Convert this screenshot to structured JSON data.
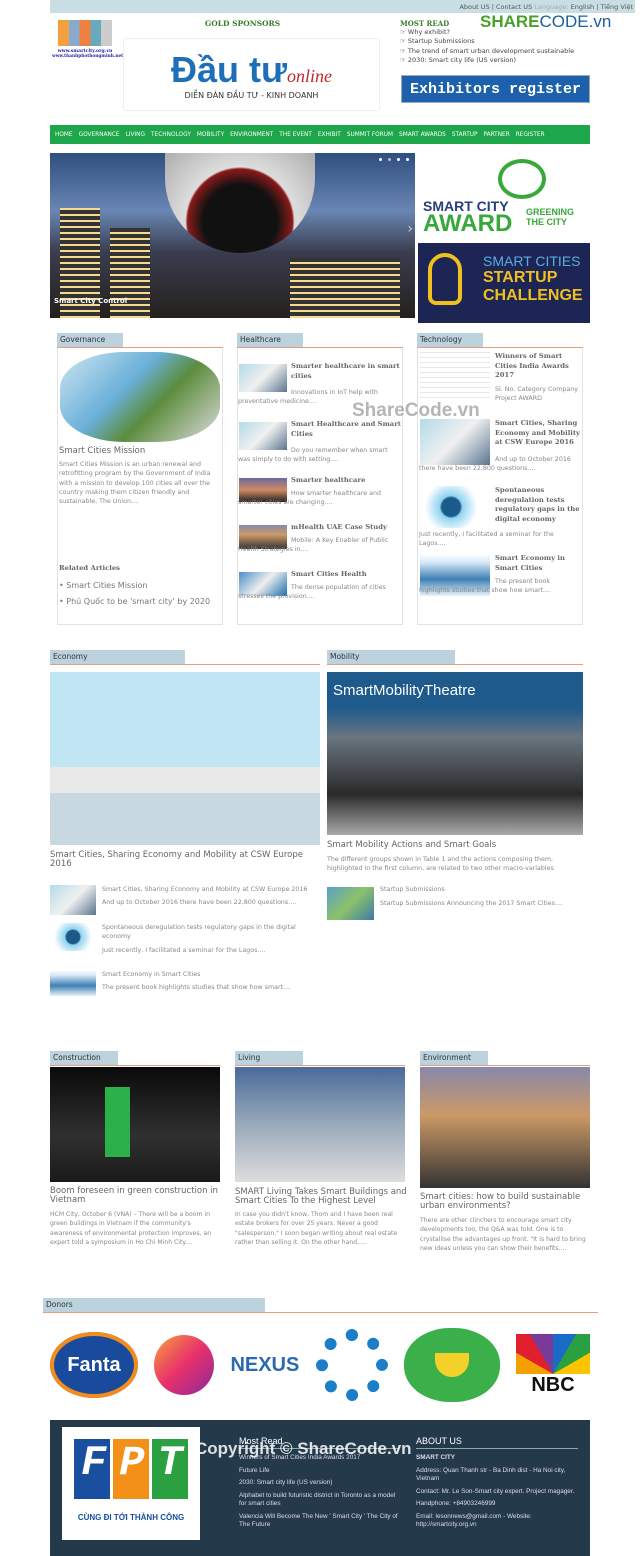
{
  "topbar": {
    "about": "About US",
    "contact": "Contact US",
    "language_label": "Language:",
    "english": "English",
    "vietnamese": "Tiếng Việt"
  },
  "logo": {
    "line1": "www.smartcity.org.vn",
    "line2": "www.thanhphothongminh.net"
  },
  "sponsors": {
    "title": "GOLD SPONSORS",
    "brand_main": "Đầu tư",
    "brand_script": "online",
    "brand_sub": "DIỄN ĐÀN ĐẦU TƯ - KINH DOANH"
  },
  "most_read_header": {
    "title": "MOST READ",
    "items": [
      "Why exhibit?",
      "Startup Submissions",
      "The trend of smart urban development sustainable",
      "2030: Smart city life (US version)"
    ]
  },
  "watermark": {
    "brand": "SHARE",
    "brand2": "CODE.vn",
    "mid": "ShareCode.vn",
    "footer": "Copyright © ShareCode.vn"
  },
  "exhibitors_banner": "Exhibitors register now",
  "nav": [
    "HOME",
    "GOVERNANCE",
    "LIVING",
    "TECHNOLOGY",
    "MOBILITY",
    "ENVIRONMENT",
    "THE EVENT",
    "EXHIBIT",
    "SUMMIT FORUM",
    "SMART AWARDS",
    "STARTUP",
    "PARTNER",
    "REGISTER"
  ],
  "hero": {
    "caption": "Smart City Control",
    "slide_count": 4,
    "active_slide": 2
  },
  "award": {
    "l1": "SMART CITY",
    "l2": "AWARD",
    "l3": "GREENING",
    "l4": "THE CITY"
  },
  "startup": {
    "l1": "SMART CITIES",
    "l2": "STARTUP",
    "l3": "CHALLENGE"
  },
  "governance": {
    "title": "Governance",
    "headline": "Smart Cities Mission",
    "summary": "Smart Cities Mission is an urban renewal and retrofitting program by the Government of India with a mission to develop 100 cities all over the country making them citizen friendly and sustainable. The Union....",
    "related_title": "Related Articles",
    "related": [
      "Smart Cities Mission",
      "Phú Quốc to be 'smart city' by 2020"
    ]
  },
  "healthcare": {
    "title": "Healthcare",
    "items": [
      {
        "title": "Smarter healthcare in smart cities",
        "text": "Innovations in IoT help with preventative medicine...."
      },
      {
        "title": "Smart Healthcare and Smart Cities",
        "text": "Do you remember when smart was simply to do with setting...."
      },
      {
        "title": "Smarter healthcare",
        "text": "How smarter healthcare and smarter cities are changing...."
      },
      {
        "title": "mHealth UAE Case Study",
        "text": "Mobile: A Key Enabler of Public Health Strategies in...."
      },
      {
        "title": "Smart Cities Health",
        "text": "The dense population of cities stresses the provision...."
      }
    ]
  },
  "technology": {
    "title": "Technology",
    "items": [
      {
        "title": "Winners of Smart Cities India Awards 2017",
        "text": "Sl. No. Category Company Project AWARD"
      },
      {
        "title": "Smart Cities, Sharing Economy and Mobility at CSW Europe 2016",
        "text": "And up to October 2016 there have been 22,800 questions...."
      },
      {
        "title": "Spontaneous deregulation tests regulatory gaps in the digital economy",
        "text": "Just recently, I facilitated a seminar for the Lagos...."
      },
      {
        "title": "Smart Economy in Smart Cities",
        "text": "The present book highlights studies that show how smart...."
      }
    ]
  },
  "economy": {
    "title": "Economy",
    "headline": "Smart Cities, Sharing Economy and Mobility at CSW Europe 2016",
    "items": [
      {
        "title": "Smart Cities, Sharing Economy and Mobility at CSW Europe 2016",
        "text": "And up to October 2016 there have been 22,800 questions...."
      },
      {
        "title": "Spontaneous deregulation tests regulatory gaps in the digital economy",
        "text": "Just recently, I facilitated a seminar for the Lagos...."
      },
      {
        "title": "Smart Economy in Smart Cities",
        "text": "The present book highlights studies that show how smart...."
      }
    ]
  },
  "mobility": {
    "title": "Mobility",
    "image_text": "SmartMobilityTheatre",
    "headline": "Smart Mobility Actions and Smart Goals",
    "summary": "The different groups shown in Table 1 and the actions composing them, highlighted in the first column, are related to two other macro-variables",
    "items": [
      {
        "title": "Startup Submissions",
        "text": "Startup Submissions Announcing the 2017 Smart Cities...."
      }
    ]
  },
  "construction": {
    "title": "Construction",
    "headline": "Boom foreseen in green construction in Vietnam",
    "summary": "HCM City, October 6 (VNA) – There will be a boom in green buildings in Vietnam if the community's awareness of environmental protection improves, an expert told a symposium in Ho Chi Minh City...."
  },
  "living": {
    "title": "Living",
    "headline": "SMART Living Takes Smart Buildings and Smart Cities To the Highest Level",
    "summary": "In case you didn't know, Thom and I have been real estate brokers for over 25 years.  Never a good \"salesperson,\" I soon began writing about real estate rather than selling it.  On the other hand,...."
  },
  "environment": {
    "title": "Environment",
    "headline": "Smart cities: how to build sustainable urban environments?",
    "summary": "There are other clinchers to encourage smart city developments too, the Q&A was told. One is to crystallise the advantages up front. \"It is hard to bring new ideas unless you can show their benefits...."
  },
  "donors": {
    "title": "Donors",
    "logos": [
      "Fanta",
      "Lion",
      "NEXUS",
      "Swirl",
      "Lotus",
      "NBC"
    ]
  },
  "footer": {
    "fpt": "FPT",
    "fpt_slogan": "CÙNG ĐI TỚI THÀNH CÔNG",
    "most_read_title": "Most Read",
    "most_read": [
      "Winners of Smart Cities India Awards 2017",
      "Future Life",
      "2030: Smart city life (US version)",
      "Alphabet to build futuristic district in Toronto as a model for smart cities",
      "Valencia Will Become The New ' Smart City ' The City of The Future"
    ],
    "about_title": "ABOUT US",
    "org": "SMART CITY",
    "address": "Address: Quan Thanh str - Ba Dinh dist - Ha Noi city, Vietnam",
    "contact": "Contact: Mr. Le Son-Smart city expert. Project magager.",
    "phone": "Handphone: +84903246999",
    "email": "Email: lesonnews@gmail.com - Website: http://smartcity.org.vn"
  }
}
